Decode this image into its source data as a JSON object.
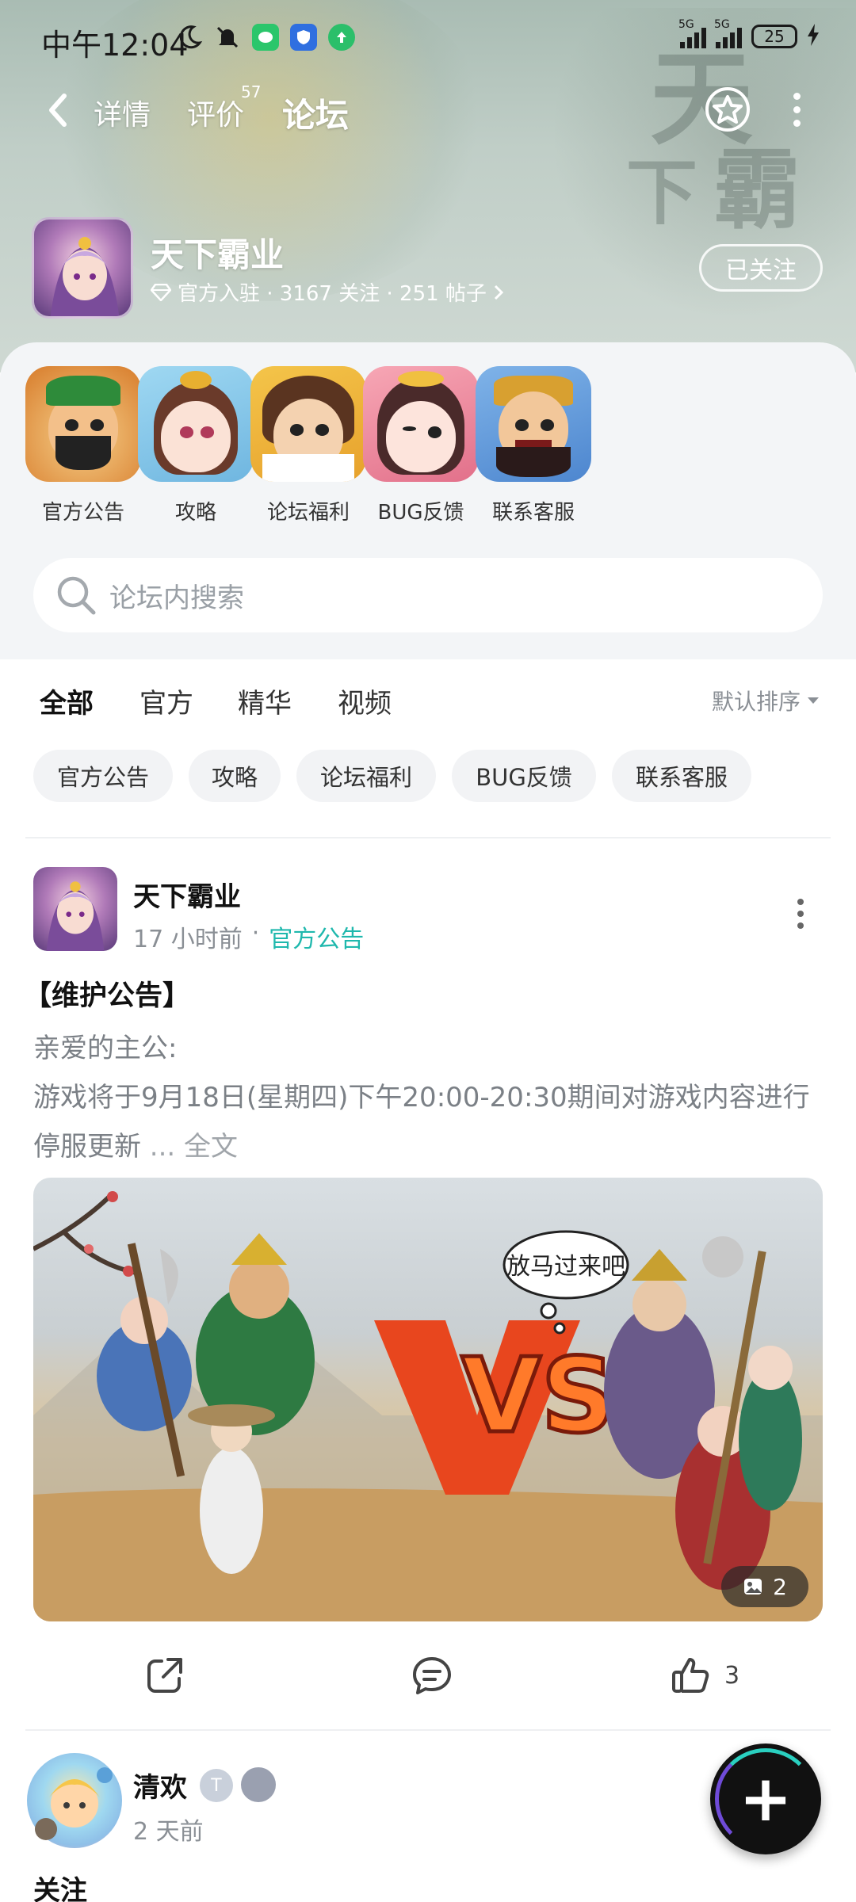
{
  "status_bar": {
    "time": "中午12:04",
    "network_1": "5G",
    "network_2": "5G",
    "battery": "25"
  },
  "nav": {
    "tabs": [
      {
        "label": "详情"
      },
      {
        "label": "评价",
        "badge": "57"
      },
      {
        "label": "论坛"
      }
    ],
    "active_tab": "论坛"
  },
  "game": {
    "title": "天下霸业",
    "meta": "官方入驻 · 3167 关注 · 251 帖子",
    "follow_label": "已关注"
  },
  "shortcuts": [
    {
      "label": "官方公告"
    },
    {
      "label": "攻略"
    },
    {
      "label": "论坛福利"
    },
    {
      "label": "BUG反馈"
    },
    {
      "label": "联系客服"
    }
  ],
  "search": {
    "placeholder": "论坛内搜索"
  },
  "filter_tabs": [
    {
      "label": "全部"
    },
    {
      "label": "官方"
    },
    {
      "label": "精华"
    },
    {
      "label": "视频"
    }
  ],
  "sort_label": "默认排序",
  "chips": [
    {
      "label": "官方公告"
    },
    {
      "label": "攻略"
    },
    {
      "label": "论坛福利"
    },
    {
      "label": "BUG反馈"
    },
    {
      "label": "联系客服"
    }
  ],
  "post": {
    "author": "天下霸业",
    "time": "17 小时前",
    "category": "官方公告",
    "title": "【维护公告】",
    "body_line1": "亲爱的主公:",
    "body_line2": "游戏将于9月18日(星期四)下午20:00-20:30期间对游戏内容进行停服更新",
    "ellipsis": " ... ",
    "full_text": "全文",
    "image_speech": "放马过来吧",
    "image_count": "2",
    "like_count": "3"
  },
  "post2": {
    "author": "清欢",
    "badge": "T",
    "time": "2 天前",
    "follow_text": "关注"
  },
  "colors": {
    "accent": "#22c3b5",
    "tag": "#1fb8ad"
  }
}
